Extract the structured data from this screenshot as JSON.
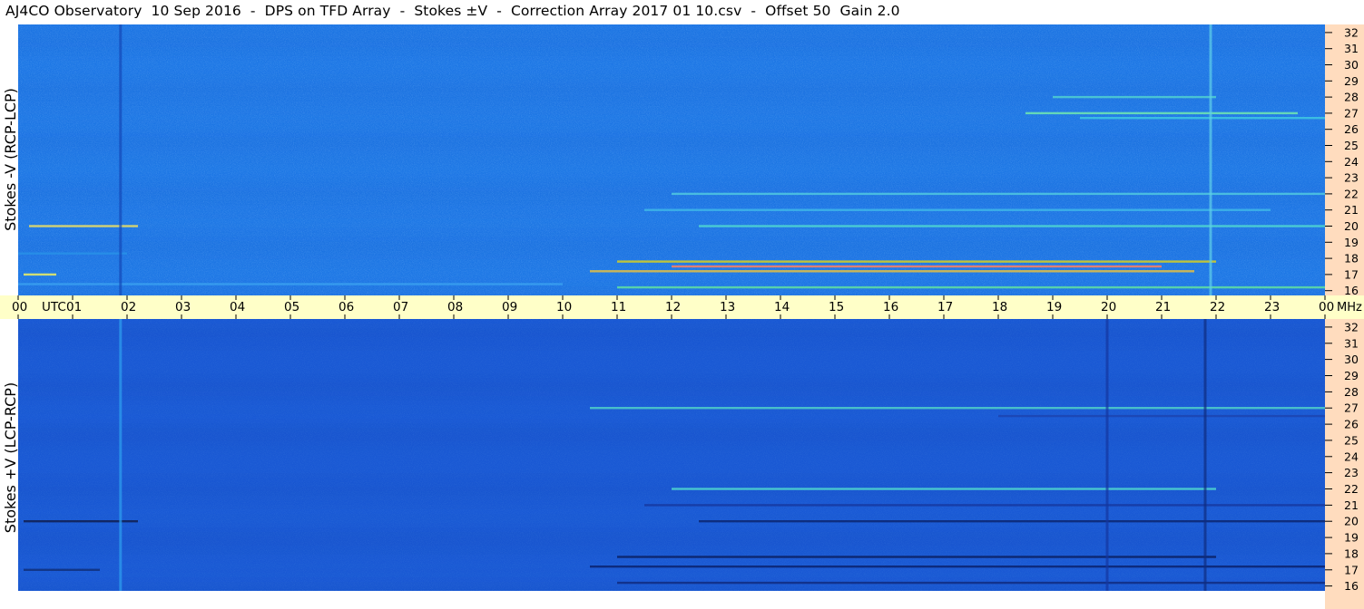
{
  "title": "AJ4CO Observatory  10 Sep 2016  -  DPS on TFD Array  -  Stokes ±V  -  Correction Array 2017 01 10.csv  -  Offset 50  Gain 2.0",
  "colors": {
    "top_background": "#1e78e6",
    "bottom_background": "#1a5ad6",
    "time_bar": "#ffffc8",
    "freq_axis_bg": "#ffdcbe"
  },
  "chart_data": [
    {
      "type": "heatmap",
      "panel": "top",
      "ylabel": "Stokes -V  (RCP-LCP)",
      "x_axis": {
        "ticks": [
          "00",
          "01",
          "02",
          "03",
          "04",
          "05",
          "06",
          "07",
          "08",
          "09",
          "10",
          "11",
          "12",
          "13",
          "14",
          "15",
          "16",
          "17",
          "18",
          "19",
          "20",
          "21",
          "22",
          "23",
          "00"
        ],
        "label_left": "UTC",
        "label_right": "MHz",
        "range_hours": [
          0,
          24
        ]
      },
      "y_axis": {
        "ticks": [
          16,
          17,
          18,
          19,
          20,
          21,
          22,
          23,
          24,
          25,
          26,
          27,
          28,
          29,
          30,
          31,
          32
        ],
        "range_mhz": [
          15.7,
          32.5
        ],
        "side": "right"
      },
      "features": [
        {
          "kind": "band",
          "freq": 17.8,
          "start": 11.0,
          "end": 22.0,
          "color": "#d8d020"
        },
        {
          "kind": "band",
          "freq": 17.2,
          "start": 10.5,
          "end": 21.6,
          "color": "#e8c040"
        },
        {
          "kind": "band",
          "freq": 17.5,
          "start": 12.0,
          "end": 21.0,
          "color": "#ff8060"
        },
        {
          "kind": "band",
          "freq": 16.2,
          "start": 11.0,
          "end": 24.0,
          "color": "#60e0a0"
        },
        {
          "kind": "band",
          "freq": 16.4,
          "start": 0.0,
          "end": 10.0,
          "color": "#3aa0f0"
        },
        {
          "kind": "band",
          "freq": 20.0,
          "start": 0.2,
          "end": 2.2,
          "color": "#f0e060"
        },
        {
          "kind": "band",
          "freq": 20.0,
          "start": 12.5,
          "end": 24.0,
          "color": "#50d8d0"
        },
        {
          "kind": "band",
          "freq": 22.0,
          "start": 12.0,
          "end": 24.0,
          "color": "#50c8e0"
        },
        {
          "kind": "band",
          "freq": 21.0,
          "start": 11.5,
          "end": 23.0,
          "color": "#40b8e8"
        },
        {
          "kind": "band",
          "freq": 27.0,
          "start": 18.5,
          "end": 23.5,
          "color": "#70e8b0"
        },
        {
          "kind": "band",
          "freq": 26.7,
          "start": 19.5,
          "end": 24.0,
          "color": "#40c8e0"
        },
        {
          "kind": "band",
          "freq": 28.0,
          "start": 19.0,
          "end": 22.0,
          "color": "#50d0d0"
        },
        {
          "kind": "band",
          "freq": 18.3,
          "start": 0.0,
          "end": 2.0,
          "color": "#2890e8"
        },
        {
          "kind": "band",
          "freq": 17.0,
          "start": 0.1,
          "end": 0.7,
          "color": "#f0f060"
        },
        {
          "kind": "vline",
          "time": 1.88,
          "color": "#1448b8"
        },
        {
          "kind": "vline",
          "time": 21.9,
          "color": "#60d0e8"
        }
      ]
    },
    {
      "type": "heatmap",
      "panel": "bottom",
      "ylabel": "Stokes +V  (LCP-RCP)",
      "x_axis": {
        "ticks": [
          "00",
          "01",
          "02",
          "03",
          "04",
          "05",
          "06",
          "07",
          "08",
          "09",
          "10",
          "11",
          "12",
          "13",
          "14",
          "15",
          "16",
          "17",
          "18",
          "19",
          "20",
          "21",
          "22",
          "23",
          "00"
        ],
        "range_hours": [
          0,
          24
        ]
      },
      "y_axis": {
        "ticks": [
          16,
          17,
          18,
          19,
          20,
          21,
          22,
          23,
          24,
          25,
          26,
          27,
          28,
          29,
          30,
          31,
          32
        ],
        "range_mhz": [
          15.7,
          32.5
        ],
        "side": "right"
      },
      "features": [
        {
          "kind": "band",
          "freq": 17.8,
          "start": 11.0,
          "end": 22.0,
          "color": "#0a1e60"
        },
        {
          "kind": "band",
          "freq": 17.2,
          "start": 10.5,
          "end": 24.0,
          "color": "#0a2270"
        },
        {
          "kind": "band",
          "freq": 16.2,
          "start": 11.0,
          "end": 24.0,
          "color": "#102c80"
        },
        {
          "kind": "band",
          "freq": 20.0,
          "start": 0.1,
          "end": 2.2,
          "color": "#101e50"
        },
        {
          "kind": "band",
          "freq": 20.0,
          "start": 12.5,
          "end": 24.0,
          "color": "#0c2670"
        },
        {
          "kind": "band",
          "freq": 22.0,
          "start": 12.0,
          "end": 22.0,
          "color": "#50d8d0"
        },
        {
          "kind": "band",
          "freq": 21.0,
          "start": 11.5,
          "end": 24.0,
          "color": "#1638a0"
        },
        {
          "kind": "band",
          "freq": 27.0,
          "start": 10.5,
          "end": 24.0,
          "color": "#50d0c8"
        },
        {
          "kind": "band",
          "freq": 26.5,
          "start": 18.0,
          "end": 24.0,
          "color": "#1c44b0"
        },
        {
          "kind": "band",
          "freq": 17.0,
          "start": 0.1,
          "end": 1.5,
          "color": "#10307a"
        },
        {
          "kind": "vline",
          "time": 1.88,
          "color": "#2ea0f0"
        },
        {
          "kind": "vline",
          "time": 21.8,
          "color": "#0e2c80"
        },
        {
          "kind": "vline",
          "time": 20.0,
          "color": "#1436a0"
        }
      ]
    }
  ]
}
